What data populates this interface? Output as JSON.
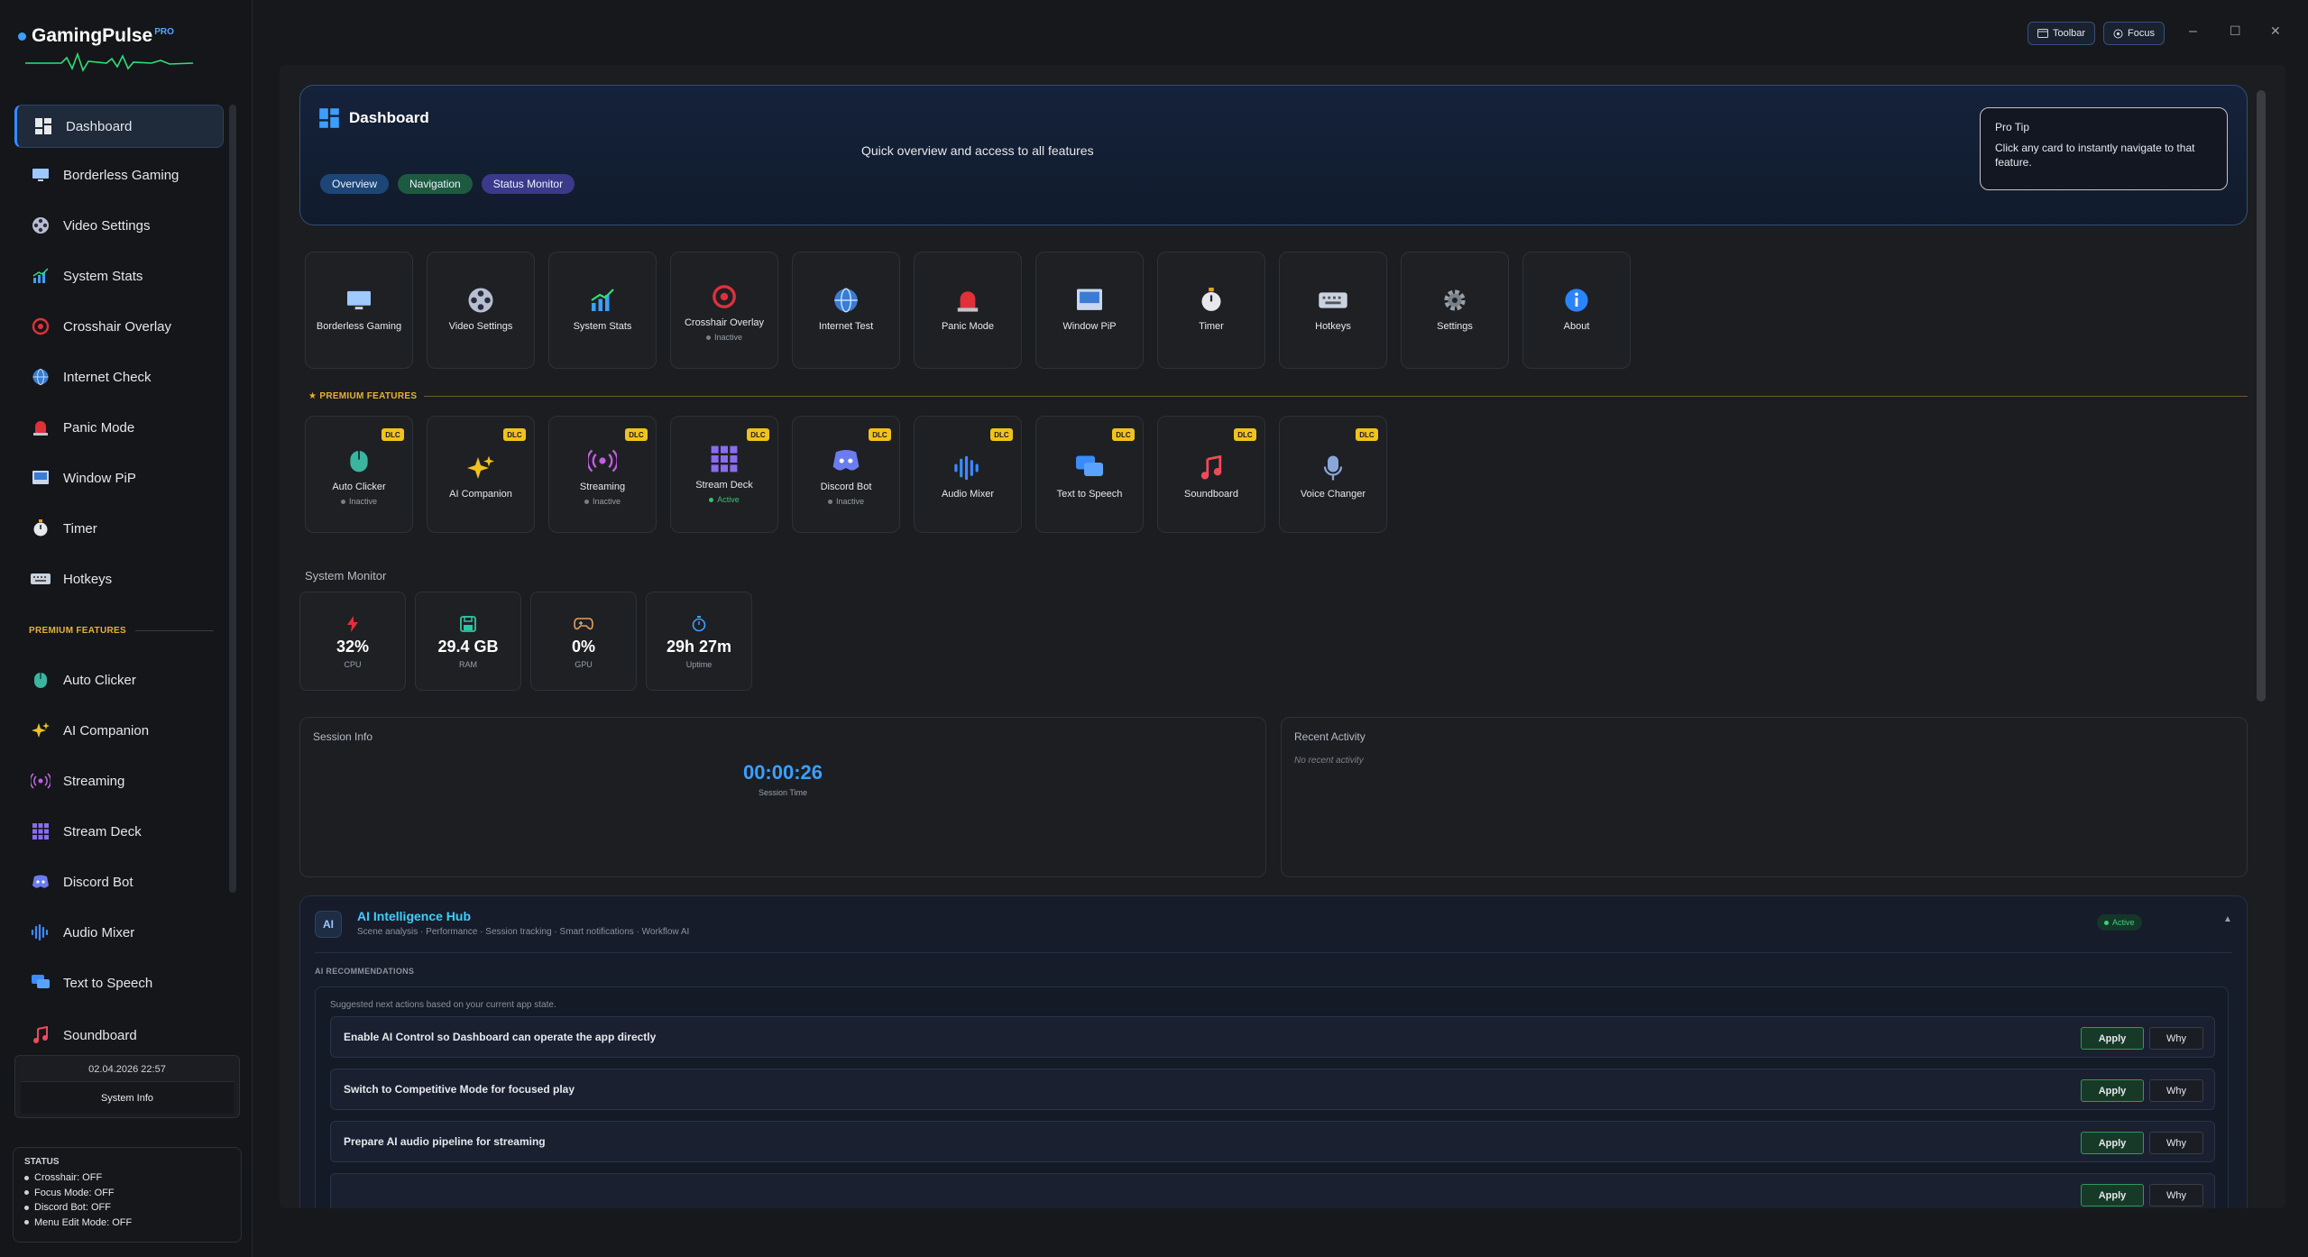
{
  "app": {
    "name": "GamingPulse",
    "badge": "PRO"
  },
  "window": {
    "toolbar_label": "Toolbar",
    "focus_label": "Focus",
    "minimize": "–",
    "maximize": "☐",
    "close": "✕"
  },
  "sidebar": {
    "items": [
      {
        "label": "Dashboard",
        "icon": "dashboard-icon"
      },
      {
        "label": "Borderless Gaming",
        "icon": "monitor-icon"
      },
      {
        "label": "Video Settings",
        "icon": "film-reel-icon"
      },
      {
        "label": "System Stats",
        "icon": "chart-icon"
      },
      {
        "label": "Crosshair Overlay",
        "icon": "crosshair-icon"
      },
      {
        "label": "Internet Check",
        "icon": "globe-icon"
      },
      {
        "label": "Panic Mode",
        "icon": "siren-icon"
      },
      {
        "label": "Window PiP",
        "icon": "pip-icon"
      },
      {
        "label": "Timer",
        "icon": "stopwatch-icon"
      },
      {
        "label": "Hotkeys",
        "icon": "keyboard-icon"
      }
    ],
    "premium_label": "PREMIUM FEATURES",
    "premium_items": [
      {
        "label": "Auto Clicker",
        "icon": "mouse-icon"
      },
      {
        "label": "AI Companion",
        "icon": "sparkles-icon"
      },
      {
        "label": "Streaming",
        "icon": "broadcast-icon"
      },
      {
        "label": "Stream Deck",
        "icon": "grid-icon"
      },
      {
        "label": "Discord Bot",
        "icon": "discord-icon"
      },
      {
        "label": "Audio Mixer",
        "icon": "waveform-icon"
      },
      {
        "label": "Text to Speech",
        "icon": "speech-bubble-icon"
      },
      {
        "label": "Soundboard",
        "icon": "music-note-icon"
      }
    ],
    "date": "02.04.2026 22:57",
    "system_info": "System Info",
    "status": {
      "title": "STATUS",
      "rows": [
        "Crosshair: OFF",
        "Focus Mode: OFF",
        "Discord Bot: OFF",
        "Menu Edit Mode: OFF"
      ]
    }
  },
  "hero": {
    "title": "Dashboard",
    "subtitle": "Quick overview and access to all features",
    "pills": [
      "Overview",
      "Navigation",
      "Status Monitor"
    ],
    "protip_title": "Pro Tip",
    "protip_text": "Click any card to instantly navigate to that feature."
  },
  "features": [
    {
      "label": "Borderless Gaming",
      "status": ""
    },
    {
      "label": "Video Settings",
      "status": ""
    },
    {
      "label": "System Stats",
      "status": ""
    },
    {
      "label": "Crosshair Overlay",
      "status": "Inactive"
    },
    {
      "label": "Internet Test",
      "status": ""
    },
    {
      "label": "Panic Mode",
      "status": ""
    },
    {
      "label": "Window PiP",
      "status": ""
    },
    {
      "label": "Timer",
      "status": ""
    },
    {
      "label": "Hotkeys",
      "status": ""
    },
    {
      "label": "Settings",
      "status": ""
    },
    {
      "label": "About",
      "status": ""
    }
  ],
  "premium_heading": "★ PREMIUM FEATURES",
  "premium": [
    {
      "label": "Auto Clicker",
      "status": "Inactive",
      "badge": "DLC"
    },
    {
      "label": "AI Companion",
      "status": "",
      "badge": "DLC"
    },
    {
      "label": "Streaming",
      "status": "Inactive",
      "badge": "DLC"
    },
    {
      "label": "Stream Deck",
      "status": "Active",
      "badge": "DLC"
    },
    {
      "label": "Discord Bot",
      "status": "Inactive",
      "badge": "DLC"
    },
    {
      "label": "Audio Mixer",
      "status": "",
      "badge": "DLC"
    },
    {
      "label": "Text to Speech",
      "status": "",
      "badge": "DLC"
    },
    {
      "label": "Soundboard",
      "status": "",
      "badge": "DLC"
    },
    {
      "label": "Voice Changer",
      "status": "",
      "badge": "DLC"
    }
  ],
  "monitor": {
    "title": "System Monitor",
    "items": [
      {
        "value": "32%",
        "label": "CPU",
        "icon": "lightning-icon"
      },
      {
        "value": "29.4 GB",
        "label": "RAM",
        "icon": "floppy-icon"
      },
      {
        "value": "0%",
        "label": "GPU",
        "icon": "gamepad-icon"
      },
      {
        "value": "29h 27m",
        "label": "Uptime",
        "icon": "stopwatch-icon"
      }
    ]
  },
  "session": {
    "title": "Session Info",
    "time": "00:00:26",
    "label": "Session Time"
  },
  "activity": {
    "title": "Recent Activity",
    "empty": "No recent activity"
  },
  "ai_hub": {
    "badge": "AI",
    "title": "AI Intelligence Hub",
    "subtitle": "Scene analysis · Performance · Session tracking · Smart notifications · Workflow AI",
    "status": "Active",
    "caret": "▲",
    "rec_label": "AI RECOMMENDATIONS",
    "hint": "Suggested next actions based on your current app state.",
    "apply_label": "Apply",
    "why_label": "Why",
    "recommendations": [
      "Enable AI Control so Dashboard can operate the app directly",
      "Switch to Competitive Mode for focused play",
      "Prepare AI audio pipeline for streaming",
      ""
    ]
  }
}
